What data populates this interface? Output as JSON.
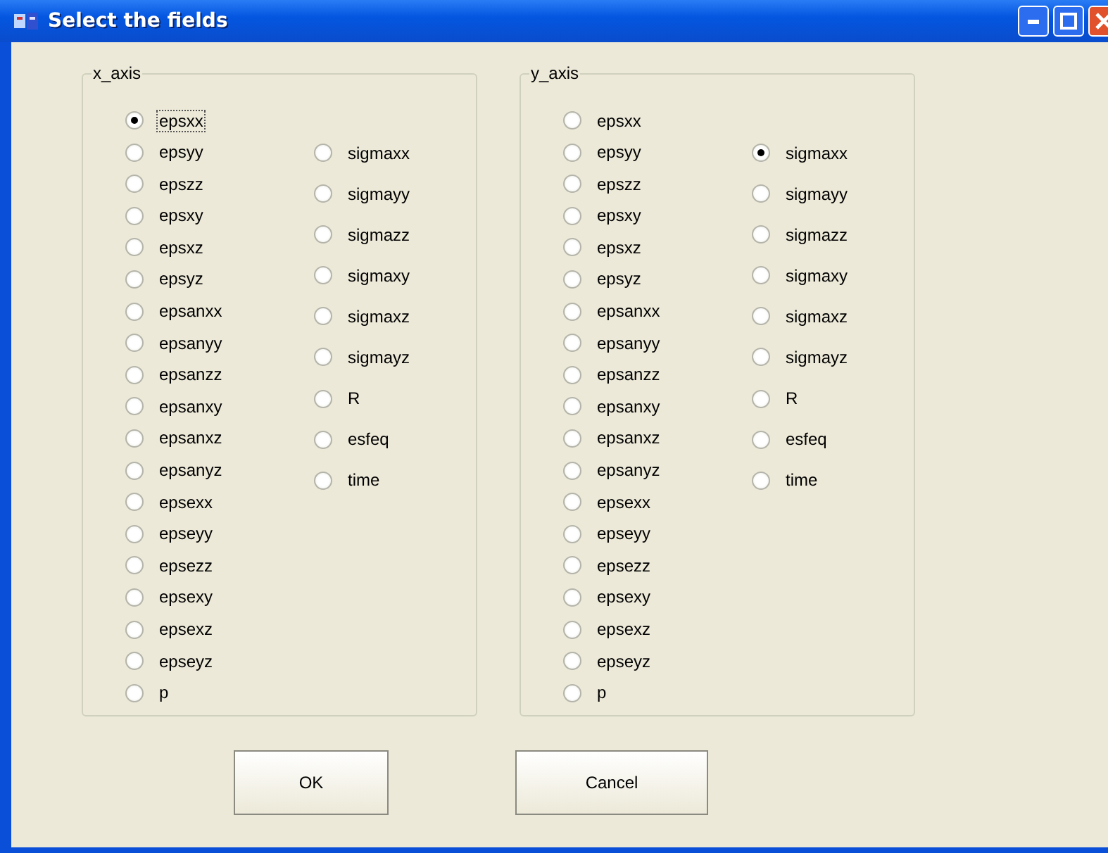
{
  "window": {
    "title": "Select the fields"
  },
  "groups": [
    {
      "label": "x_axis",
      "columns": [
        [
          {
            "label": "epsxx",
            "selected": true,
            "focused": true
          },
          {
            "label": "epsyy",
            "selected": false,
            "focused": false
          },
          {
            "label": "epszz",
            "selected": false,
            "focused": false
          },
          {
            "label": "epsxy",
            "selected": false,
            "focused": false
          },
          {
            "label": "epsxz",
            "selected": false,
            "focused": false
          },
          {
            "label": "epsyz",
            "selected": false,
            "focused": false
          },
          {
            "label": "epsanxx",
            "selected": false,
            "focused": false
          },
          {
            "label": "epsanyy",
            "selected": false,
            "focused": false
          },
          {
            "label": "epsanzz",
            "selected": false,
            "focused": false
          },
          {
            "label": "epsanxy",
            "selected": false,
            "focused": false
          },
          {
            "label": "epsanxz",
            "selected": false,
            "focused": false
          },
          {
            "label": "epsanyz",
            "selected": false,
            "focused": false
          },
          {
            "label": "epsexx",
            "selected": false,
            "focused": false
          },
          {
            "label": "epseyy",
            "selected": false,
            "focused": false
          },
          {
            "label": "epsezz",
            "selected": false,
            "focused": false
          },
          {
            "label": "epsexy",
            "selected": false,
            "focused": false
          },
          {
            "label": "epsexz",
            "selected": false,
            "focused": false
          },
          {
            "label": "epseyz",
            "selected": false,
            "focused": false
          },
          {
            "label": "p",
            "selected": false,
            "focused": false
          }
        ],
        [
          {
            "label": "sigmaxx",
            "selected": false,
            "focused": false
          },
          {
            "label": "sigmayy",
            "selected": false,
            "focused": false
          },
          {
            "label": "sigmazz",
            "selected": false,
            "focused": false
          },
          {
            "label": "sigmaxy",
            "selected": false,
            "focused": false
          },
          {
            "label": "sigmaxz",
            "selected": false,
            "focused": false
          },
          {
            "label": "sigmayz",
            "selected": false,
            "focused": false
          },
          {
            "label": "R",
            "selected": false,
            "focused": false
          },
          {
            "label": "esfeq",
            "selected": false,
            "focused": false
          },
          {
            "label": "time",
            "selected": false,
            "focused": false
          }
        ]
      ]
    },
    {
      "label": "y_axis",
      "columns": [
        [
          {
            "label": "epsxx",
            "selected": false,
            "focused": false
          },
          {
            "label": "epsyy",
            "selected": false,
            "focused": false
          },
          {
            "label": "epszz",
            "selected": false,
            "focused": false
          },
          {
            "label": "epsxy",
            "selected": false,
            "focused": false
          },
          {
            "label": "epsxz",
            "selected": false,
            "focused": false
          },
          {
            "label": "epsyz",
            "selected": false,
            "focused": false
          },
          {
            "label": "epsanxx",
            "selected": false,
            "focused": false
          },
          {
            "label": "epsanyy",
            "selected": false,
            "focused": false
          },
          {
            "label": "epsanzz",
            "selected": false,
            "focused": false
          },
          {
            "label": "epsanxy",
            "selected": false,
            "focused": false
          },
          {
            "label": "epsanxz",
            "selected": false,
            "focused": false
          },
          {
            "label": "epsanyz",
            "selected": false,
            "focused": false
          },
          {
            "label": "epsexx",
            "selected": false,
            "focused": false
          },
          {
            "label": "epseyy",
            "selected": false,
            "focused": false
          },
          {
            "label": "epsezz",
            "selected": false,
            "focused": false
          },
          {
            "label": "epsexy",
            "selected": false,
            "focused": false
          },
          {
            "label": "epsexz",
            "selected": false,
            "focused": false
          },
          {
            "label": "epseyz",
            "selected": false,
            "focused": false
          },
          {
            "label": "p",
            "selected": false,
            "focused": false
          }
        ],
        [
          {
            "label": "sigmaxx",
            "selected": true,
            "focused": false
          },
          {
            "label": "sigmayy",
            "selected": false,
            "focused": false
          },
          {
            "label": "sigmazz",
            "selected": false,
            "focused": false
          },
          {
            "label": "sigmaxy",
            "selected": false,
            "focused": false
          },
          {
            "label": "sigmaxz",
            "selected": false,
            "focused": false
          },
          {
            "label": "sigmayz",
            "selected": false,
            "focused": false
          },
          {
            "label": "R",
            "selected": false,
            "focused": false
          },
          {
            "label": "esfeq",
            "selected": false,
            "focused": false
          },
          {
            "label": "time",
            "selected": false,
            "focused": false
          }
        ]
      ]
    }
  ],
  "buttons": [
    "OK",
    "Cancel"
  ]
}
